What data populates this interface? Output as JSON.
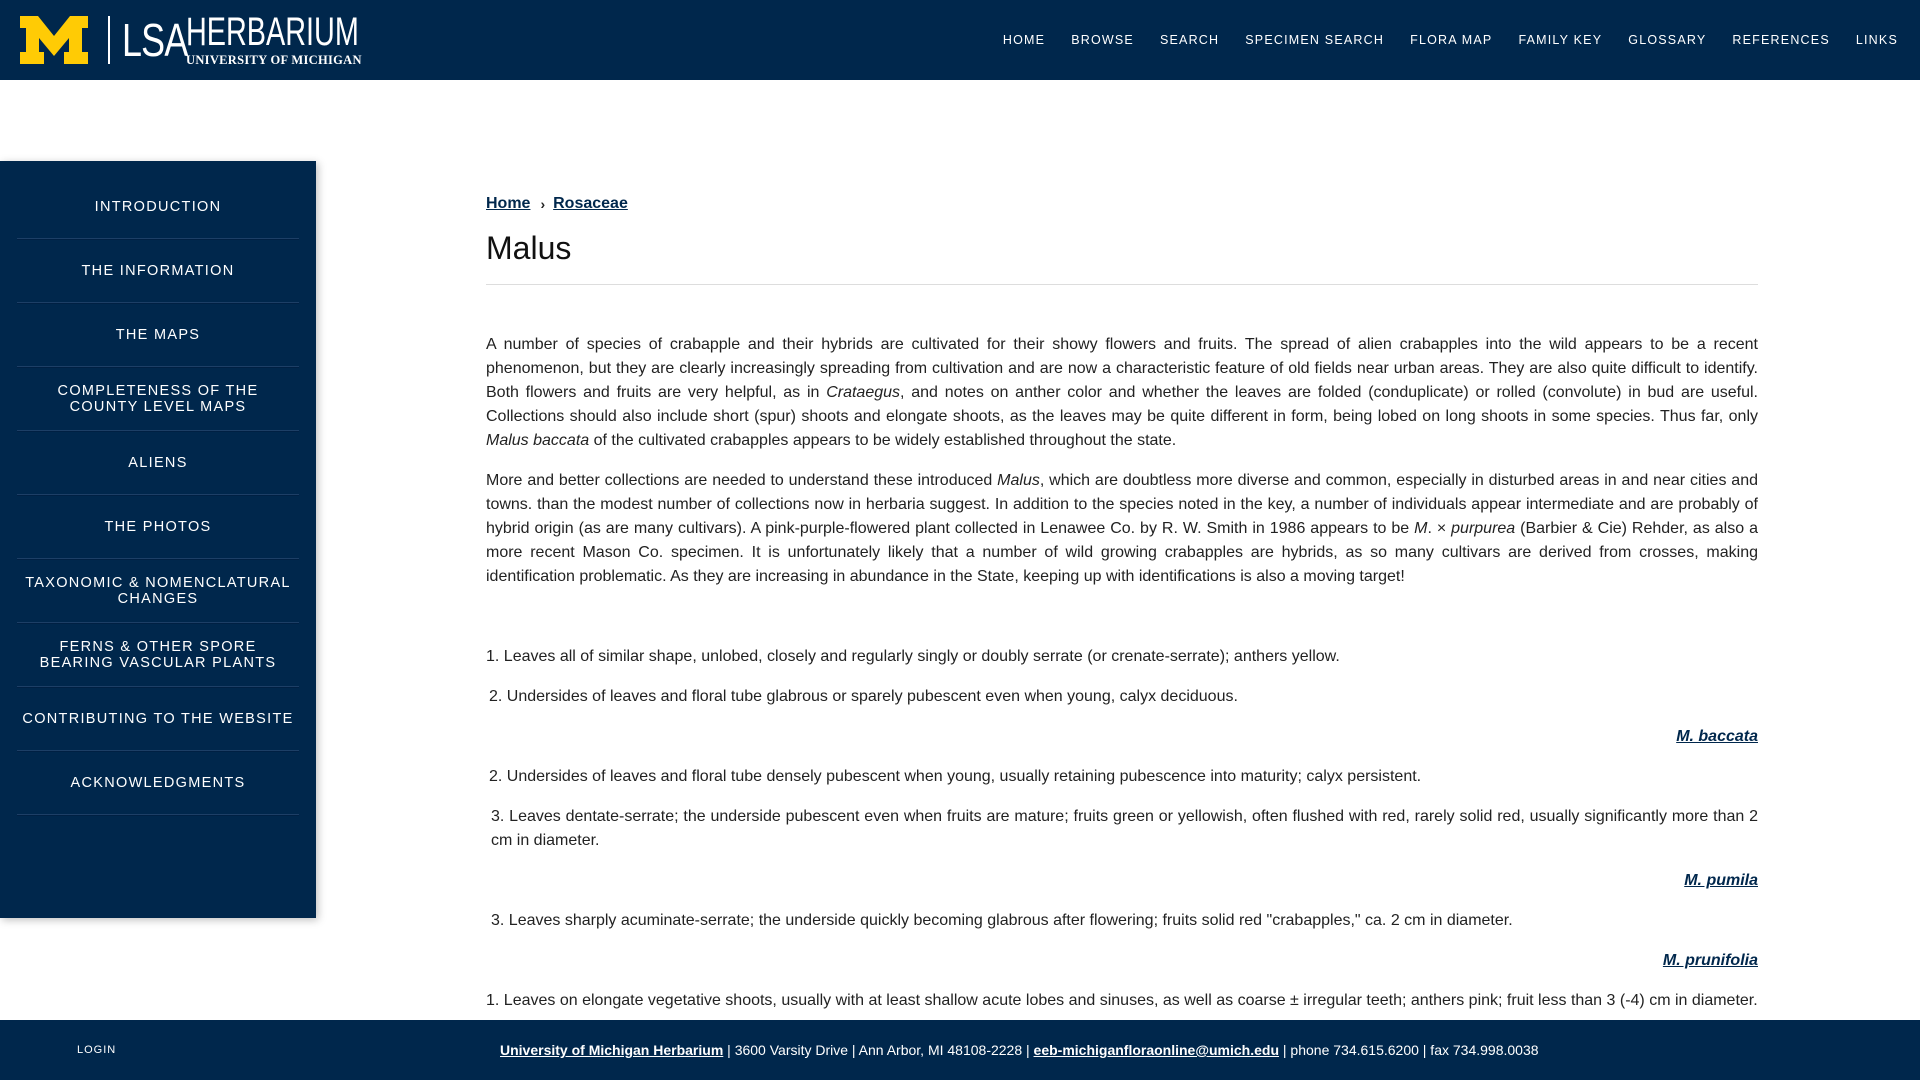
{
  "header": {
    "logo_letter": "M",
    "logo_unit": "LSA",
    "logo_title": "HERBARIUM",
    "logo_subtitle": "UNIVERSITY OF MICHIGAN",
    "brand_color": "#00274c",
    "accent_color": "#ffcb05"
  },
  "nav": [
    "HOME",
    "BROWSE",
    "SEARCH",
    "SPECIMEN SEARCH",
    "FLORA MAP",
    "FAMILY KEY",
    "GLOSSARY",
    "REFERENCES",
    "LINKS"
  ],
  "sidebar": {
    "items": [
      "INTRODUCTION",
      "THE INFORMATION",
      "THE MAPS",
      "COMPLETENESS OF THE COUNTY LEVEL MAPS",
      "ALIENS",
      "THE PHOTOS",
      "TAXONOMIC & NOMENCLATURAL CHANGES",
      "FERNS & OTHER SPORE BEARING VASCULAR PLANTS",
      "CONTRIBUTING TO THE WEBSITE",
      "ACKNOWLEDGMENTS"
    ]
  },
  "breadcrumb": {
    "home": "Home",
    "separator": "›",
    "family": " Rosaceae"
  },
  "page": {
    "title": "Malus",
    "p1": {
      "a": "A number of species of crabapple and their hybrids are cultivated for their showy flowers and fruits. The spread of alien crabapples into the wild appears to be a recent phenomenon, but they are clearly increasingly spreading from cultivation and are now a characteristic feature of old fields near urban areas. They are also quite difficult to identify. Both flowers and fruits are very helpful, as in ",
      "b": "Crataegus",
      "c": ", and notes on anther color and whether the leaves are folded (conduplicate) or rolled (convolute) in bud are useful. Collections should also include short (spur) shoots and elongate shoots, as the leaves may be quite different in form, being lobed on long shoots in some species. Thus far, only ",
      "d": "Malus baccata",
      "e": " of the cultivated crabapples appears to be widely established throughout the state."
    },
    "p2": {
      "a": "More and better collections are needed to understand these introduced ",
      "b": "Malus",
      "c": ", which are doubtless more diverse and common, especially in disturbed areas in and near cities and towns. than the modest number of collections now in herbaria suggest. In addition to the species noted in the key, a number of individuals appear intermediate and are probably of hybrid origin (as are many cultivars). A pink-purple-flowered plant collected in Lenawee Co. by R. W. Smith in 1986 appears to be ",
      "d": "M",
      "e": ". × ",
      "f": "purpurea",
      "g": " (Barbier & Cie) Rehder, as also a more recent Mason Co. specimen. It is unfortunately likely that a number of wild growing crabapples are hybrids, as so many cultivars are derived from crosses, making identification problematic. As they are increasing in abundance in the State, keeping up with identifications is also a moving target!"
    }
  },
  "key": {
    "l1": "1. Leaves all of similar shape, unlobed, closely and regularly singly or doubly serrate (or crenate-serrate); anthers yellow.",
    "l2a": "2. Undersides of leaves and floral tube glabrous or sparely pubescent even when young, calyx deciduous.",
    "t1": "M. baccata",
    "l2b": "2. Undersides of leaves and floral tube densely pubescent when young, usually retaining pubescence into maturity; calyx persistent.",
    "l3a": "3. Leaves dentate-serrate; the underside pubescent even when fruits are mature; fruits green or yellowish, often flushed with red, rarely solid red, usually significantly more than 2 cm in diameter.",
    "t2": "M. pumila",
    "l3b": "3. Leaves sharply acuminate-serrate; the underside quickly becoming glabrous after flowering; fruits solid red \"crabapples,\" ca. 2 cm in diameter.",
    "t3": "M. prunifolia",
    "l1b": "1. Leaves on elongate vegetative shoots, usually with at least shallow acute lobes and sinuses, as well as coarse ± irregular teeth; anthers pink; fruit less than 3 (-4) cm in diameter."
  },
  "footer": {
    "login": "LOGIN",
    "org": "University of Michigan Herbarium",
    "address": " | 3600 Varsity Drive | Ann Arbor, MI 48108-2228 | ",
    "email": "eeb-michiganfloraonline@umich.edu",
    "contact": " | phone 734.615.6200 | fax 734.998.0038"
  }
}
